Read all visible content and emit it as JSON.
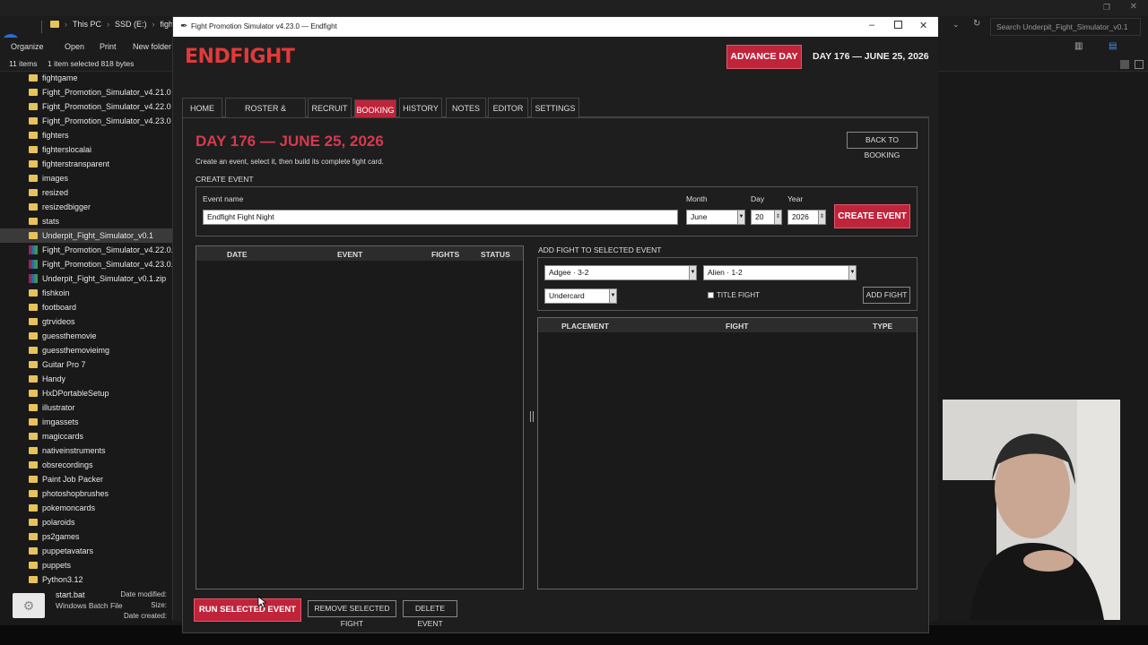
{
  "explorer": {
    "address": {
      "crumbs": [
        "This PC",
        "SSD (E:)",
        "fight"
      ],
      "search_placeholder": "Search Underpit_Fight_Simulator_v0.1"
    },
    "toolbar": {
      "organize": "Organize",
      "open": "Open",
      "print": "Print",
      "new_folder": "New folder"
    },
    "status": {
      "items": "11 items",
      "selected": "1 item selected  818 bytes"
    },
    "tree": [
      {
        "label": "fightgame",
        "icon": "folder-icon"
      },
      {
        "label": "Fight_Promotion_Simulator_v4.21.0",
        "icon": "folder-icon"
      },
      {
        "label": "Fight_Promotion_Simulator_v4.22.0",
        "icon": "folder-icon"
      },
      {
        "label": "Fight_Promotion_Simulator_v4.23.0",
        "icon": "folder-icon"
      },
      {
        "label": "fighters",
        "icon": "folder-icon"
      },
      {
        "label": "fighterslocalai",
        "icon": "folder-icon"
      },
      {
        "label": "fighterstransparent",
        "icon": "folder-icon"
      },
      {
        "label": "images",
        "icon": "folder-icon"
      },
      {
        "label": "resized",
        "icon": "folder-icon"
      },
      {
        "label": "resizedbigger",
        "icon": "folder-icon"
      },
      {
        "label": "stats",
        "icon": "folder-icon"
      },
      {
        "label": "Underpit_Fight_Simulator_v0.1",
        "icon": "folder-icon"
      },
      {
        "label": "Fight_Promotion_Simulator_v4.22.0...",
        "icon": "archive-icon"
      },
      {
        "label": "Fight_Promotion_Simulator_v4.23.0...",
        "icon": "archive-icon"
      },
      {
        "label": "Underpit_Fight_Simulator_v0.1.zip",
        "icon": "zip-icon"
      },
      {
        "label": "fishkoin",
        "icon": "folder-icon"
      },
      {
        "label": "footboard",
        "icon": "folder-icon"
      },
      {
        "label": "gtrvideos",
        "icon": "folder-icon"
      },
      {
        "label": "guessthemovie",
        "icon": "folder-icon"
      },
      {
        "label": "guessthemovieimg",
        "icon": "folder-icon"
      },
      {
        "label": "Guitar Pro 7",
        "icon": "folder-icon"
      },
      {
        "label": "Handy",
        "icon": "folder-icon"
      },
      {
        "label": "HxDPortableSetup",
        "icon": "folder-icon"
      },
      {
        "label": "illustrator",
        "icon": "folder-icon"
      },
      {
        "label": "imgassets",
        "icon": "folder-icon"
      },
      {
        "label": "magiccards",
        "icon": "folder-icon"
      },
      {
        "label": "nativeinstruments",
        "icon": "folder-icon"
      },
      {
        "label": "obsrecordings",
        "icon": "folder-icon"
      },
      {
        "label": "Paint Job Packer",
        "icon": "folder-icon"
      },
      {
        "label": "photoshopbrushes",
        "icon": "folder-icon"
      },
      {
        "label": "pokemoncards",
        "icon": "folder-icon"
      },
      {
        "label": "polaroids",
        "icon": "folder-icon"
      },
      {
        "label": "ps2games",
        "icon": "folder-icon"
      },
      {
        "label": "puppetavatars",
        "icon": "folder-icon"
      },
      {
        "label": "puppets",
        "icon": "folder-icon"
      },
      {
        "label": "Python3.12",
        "icon": "folder-icon"
      }
    ],
    "details": {
      "name": "start.bat",
      "type": "Windows Batch File",
      "date_modified": "Date modified:",
      "size": "Size:",
      "date_created": "Date created:"
    }
  },
  "window": {
    "title": "Fight Promotion Simulator v4.23.0 — Endfight"
  },
  "app": {
    "logo": "ENDFIGHT",
    "advance_day": "ADVANCE DAY",
    "current_date": "DAY 176 — JUNE 25, 2026",
    "tabs": [
      "HOME",
      "ROSTER & RECORDS",
      "RECRUIT",
      "BOOKING",
      "HISTORY",
      "NOTES",
      "EDITOR",
      "SETTINGS"
    ],
    "active_tab": "BOOKING",
    "panel": {
      "heading": "DAY 176 — JUNE 25, 2026",
      "subtitle": "Create an event, select it, then build its complete fight card.",
      "back_button": "BACK TO BOOKING",
      "create_event": {
        "section_label": "CREATE EVENT",
        "event_name_label": "Event name",
        "event_name_value": "Endfight Fight Night",
        "month_label": "Month",
        "month_value": "June",
        "day_label": "Day",
        "day_value": "20",
        "year_label": "Year",
        "year_value": "2026",
        "create_button": "CREATE EVENT"
      },
      "events_table": {
        "columns": [
          "DATE",
          "EVENT",
          "FIGHTS",
          "STATUS"
        ],
        "rows": []
      },
      "add_fight": {
        "section_label": "ADD FIGHT TO SELECTED EVENT",
        "fighter_a": "Adgee · 3-2",
        "fighter_b": "Alien · 1-2",
        "placement": "Undercard",
        "title_fight_label": "TITLE FIGHT",
        "add_button": "ADD FIGHT"
      },
      "fights_table": {
        "columns": [
          "PLACEMENT",
          "FIGHT",
          "TYPE"
        ],
        "rows": []
      },
      "run_button": "RUN SELECTED EVENT",
      "remove_fight_button": "REMOVE SELECTED FIGHT",
      "delete_event_button": "DELETE EVENT"
    }
  },
  "colors": {
    "accent": "#c0243b",
    "background": "#1e1e1e",
    "logo": "#e03a3a"
  }
}
